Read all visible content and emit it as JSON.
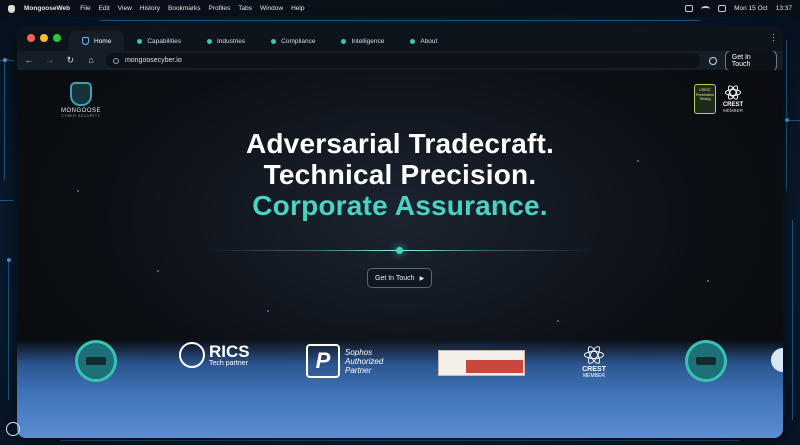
{
  "menubar": {
    "app_name": "MongooseWeb",
    "items": [
      "File",
      "Edit",
      "View",
      "History",
      "Bookmarks",
      "Profiles",
      "Tabs",
      "Window",
      "Help"
    ],
    "date": "Mon 15 Oct",
    "time": "13:37"
  },
  "browser": {
    "tabs": [
      {
        "label": "Home",
        "active": true,
        "icon": "shield-icon"
      },
      {
        "label": "Capabilities",
        "active": false
      },
      {
        "label": "Industries",
        "active": false
      },
      {
        "label": "Compliance",
        "active": false
      },
      {
        "label": "Intelligence",
        "active": false
      },
      {
        "label": "About",
        "active": false
      }
    ],
    "url": "mongoosecyber.io",
    "toolbar_cta": "Get In Touch"
  },
  "page": {
    "logo": {
      "name": "MONGOOSE",
      "tagline": "CYBER SECURITY"
    },
    "crest_badge": {
      "label": "CREST",
      "sub": "MEMBER",
      "pen_badge_text": "CREST Penetration Testing"
    },
    "hero": {
      "line1": "Adversarial Tradecraft.",
      "line2": "Technical Precision.",
      "line3": "Corporate Assurance."
    },
    "cta": {
      "label": "Get In Touch",
      "arrow": "▶"
    },
    "partners": {
      "rics": {
        "name": "RICS",
        "sub": "Tech partner"
      },
      "sophos": {
        "line1": "Sophos",
        "line2": "Authorized",
        "line3": "Partner"
      },
      "crest": {
        "label": "CREST",
        "sub": "MEMBER"
      }
    }
  },
  "colors": {
    "accent": "#49d3c3",
    "window_bg": "#0b0f14",
    "partner_band": "#3f74b8"
  }
}
